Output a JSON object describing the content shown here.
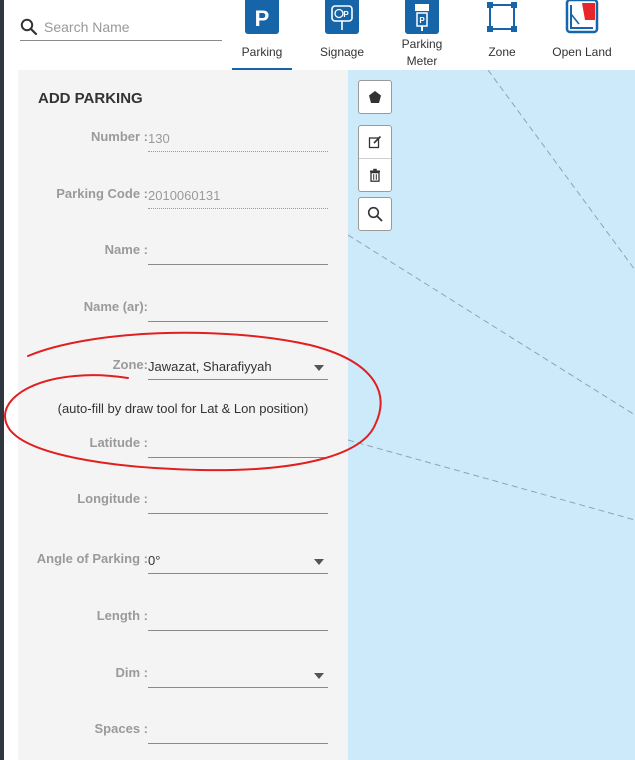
{
  "search": {
    "placeholder": "Search Name"
  },
  "tabs": [
    {
      "label": "Parking",
      "icon": "parking-p-icon",
      "active": true
    },
    {
      "label": "Signage",
      "icon": "signage-icon"
    },
    {
      "label_line1": "Parking",
      "label_line2": "Meter",
      "icon": "parking-meter-icon"
    },
    {
      "label": "Zone",
      "icon": "zone-polygon-icon"
    },
    {
      "label": "Open Land",
      "icon": "open-land-icon"
    }
  ],
  "form": {
    "title": "ADD PARKING",
    "number": {
      "label": "Number :",
      "value": "130"
    },
    "parking_code": {
      "label": "Parking Code :",
      "value": "2010060131"
    },
    "name": {
      "label": "Name :",
      "value": ""
    },
    "name_ar": {
      "label": "Name (ar):",
      "value": ""
    },
    "zone": {
      "label": "Zone:",
      "value": "Jawazat, Sharafiyyah"
    },
    "hint": "(auto-fill by draw tool for Lat & Lon position)",
    "latitude": {
      "label": "Latitude :",
      "value": ""
    },
    "longitude": {
      "label": "Longitude :",
      "value": ""
    },
    "angle": {
      "label": "Angle of Parking :",
      "value": "0°"
    },
    "length": {
      "label": "Length :",
      "value": ""
    },
    "dim": {
      "label": "Dim :",
      "value": ""
    },
    "spaces": {
      "label": "Spaces :",
      "value": ""
    }
  },
  "map_tools": [
    "draw-polygon-icon",
    "edit-icon",
    "trash-icon",
    "search-icon"
  ],
  "colors": {
    "brand": "#1565a8",
    "panel": "#f4f4f4",
    "map": "#cdeafb",
    "annotation": "#e02020",
    "open_land_red": "#e8262a"
  }
}
